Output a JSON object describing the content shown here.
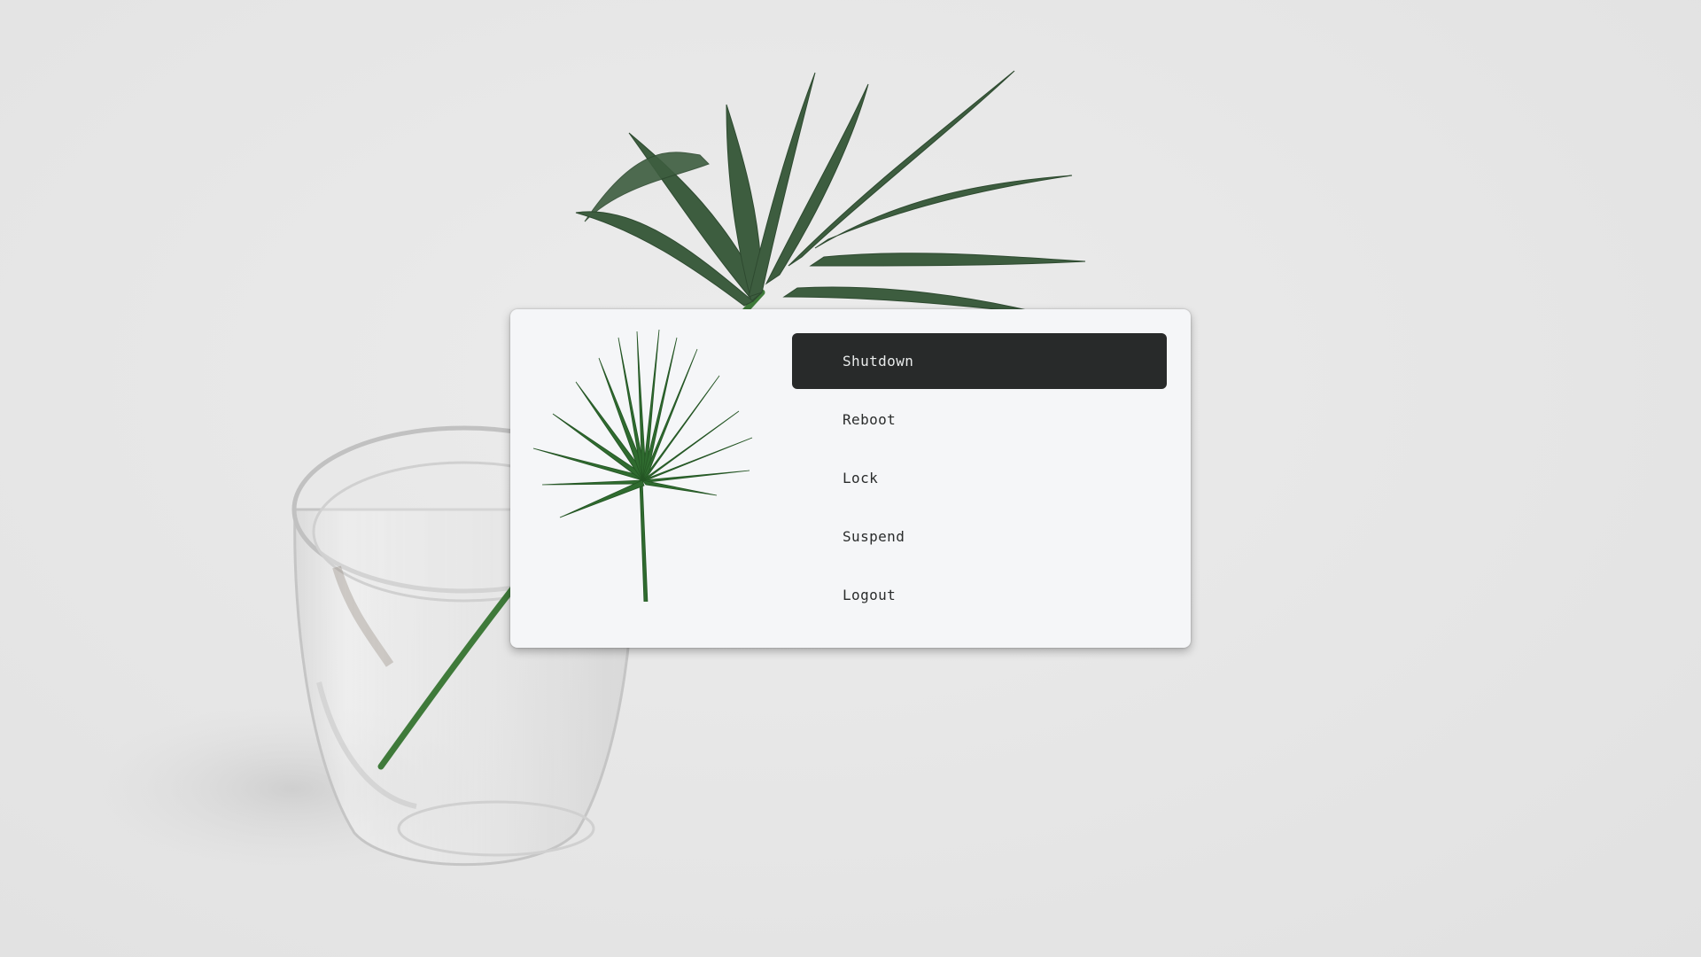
{
  "wallpaper": {
    "description_icon": "palm-leaf-in-glass",
    "background_color": "#e6e6e6"
  },
  "menu": {
    "image_icon": "fan-palm-leaf-icon",
    "items": [
      {
        "label": "Shutdown",
        "selected": true
      },
      {
        "label": "Reboot",
        "selected": false
      },
      {
        "label": "Lock",
        "selected": false
      },
      {
        "label": "Suspend",
        "selected": false
      },
      {
        "label": "Logout",
        "selected": false
      }
    ],
    "colors": {
      "panel": "#f5f6f8",
      "selected_bg": "#282a2a",
      "selected_text": "#e9ebeb",
      "text": "#2a2c2c",
      "leaf_green": "#2f6b2f"
    }
  }
}
